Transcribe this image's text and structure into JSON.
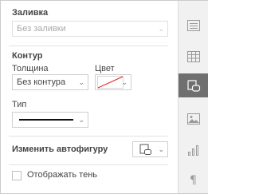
{
  "fill": {
    "title": "Заливка",
    "value": "Без заливки"
  },
  "stroke": {
    "title": "Контур",
    "thickness_label": "Толщина",
    "thickness_value": "Без контура",
    "color_label": "Цвет",
    "color_value_icon": "no-color-diagonal-icon",
    "type_label": "Тип",
    "type_value_icon": "solid-line-icon"
  },
  "change_shape": {
    "label": "Изменить автофигуру",
    "icon": "shape-icon"
  },
  "shadow": {
    "label": "Отображать тень",
    "checked": false
  },
  "sidebar": {
    "items": [
      {
        "name": "paragraph-settings",
        "icon": "text-block-icon",
        "active": false
      },
      {
        "name": "table-settings",
        "icon": "table-icon",
        "active": false
      },
      {
        "name": "shape-settings",
        "icon": "shape-icon",
        "active": true
      },
      {
        "name": "image-settings",
        "icon": "image-icon",
        "active": false
      },
      {
        "name": "chart-settings",
        "icon": "chart-icon",
        "active": false
      },
      {
        "name": "text-settings",
        "icon": "pilcrow-icon",
        "active": false
      }
    ]
  },
  "colors": {
    "active_rail": "#6f6f6f",
    "no_color_slash": "#e02020"
  }
}
